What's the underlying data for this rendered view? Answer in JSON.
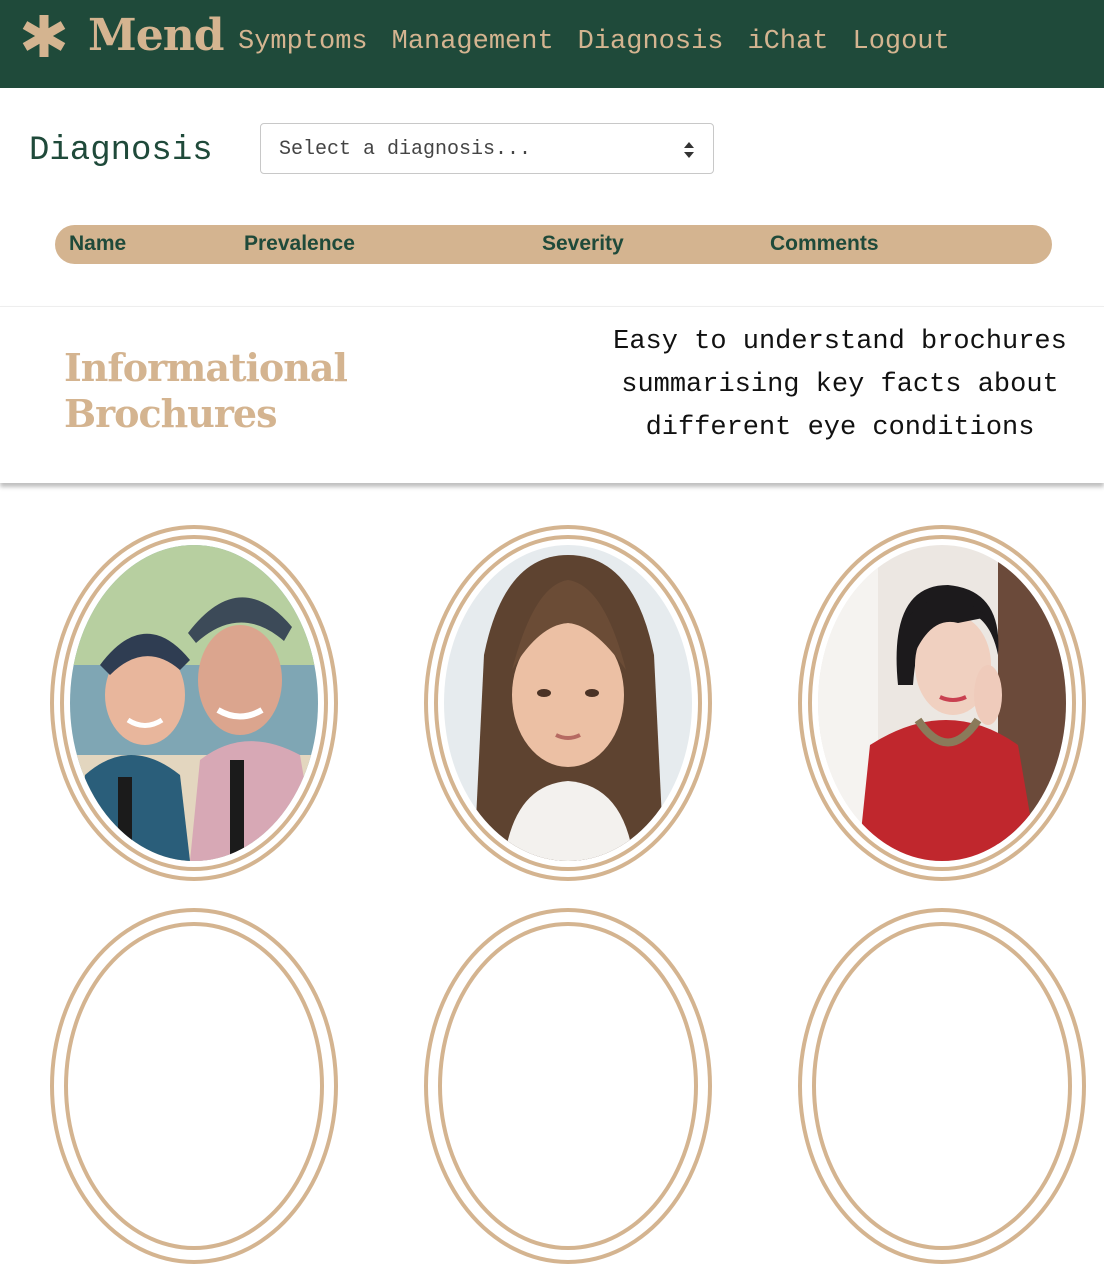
{
  "nav": {
    "brand": "Mend",
    "brand_icon": "asterisk-icon",
    "links": [
      "Symptoms",
      "Management",
      "Diagnosis",
      "iChat",
      "Logout"
    ]
  },
  "diagnosis": {
    "label": "Diagnosis",
    "select_value": "Select a diagnosis..."
  },
  "table": {
    "headers": [
      "Name",
      "Prevalence",
      "Severity",
      "Comments"
    ]
  },
  "brochures": {
    "title": "Informational Brochures",
    "description": "Easy to understand brochures summarising key facts about different eye conditions"
  },
  "colors": {
    "primary": "#1f4a3a",
    "accent": "#d4b490"
  }
}
